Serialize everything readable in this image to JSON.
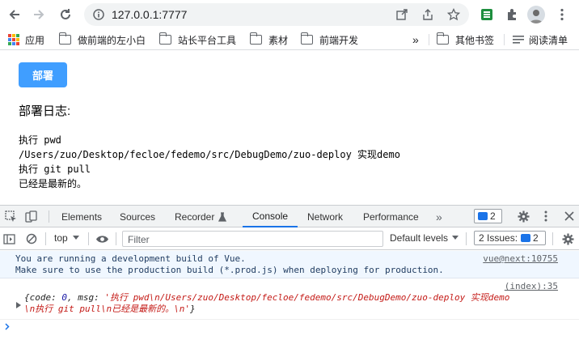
{
  "browser": {
    "url": "127.0.0.1:7777",
    "bookmarks": [
      "应用",
      "做前端的左小白",
      "站长平台工具",
      "素材",
      "前端开发"
    ],
    "more": "»",
    "other_bookmarks": "其他书签",
    "reading_list": "阅读清单"
  },
  "page": {
    "deploy_button": "部署",
    "log_title": "部署日志:",
    "log_lines": [
      "执行 pwd",
      "/Users/zuo/Desktop/fecloe/fedemo/src/DebugDemo/zuo-deploy 实现demo",
      "执行 git pull",
      "已经是最新的。"
    ]
  },
  "devtools": {
    "tabs": [
      "Elements",
      "Sources",
      "Recorder",
      "Console",
      "Network",
      "Performance"
    ],
    "active_tab": "Console",
    "more_tabs": "»",
    "issues_badge": "2",
    "context": "top",
    "filter_placeholder": "Filter",
    "levels": "Default levels",
    "issues_label": "2 Issues:",
    "issues_count": "2",
    "message1": {
      "line1": "You are running a development build of Vue.",
      "line2": "Make sure to use the production build (*.prod.js) when deploying for production.",
      "source": "vue@next:10755"
    },
    "message2": {
      "source": "(index):35",
      "open": "{",
      "k_code": "code",
      "v_code": "0",
      "k_msg": "msg",
      "v_msg_line1": "'执行 pwd\\n/Users/zuo/Desktop/fecloe/fedemo/src/DebugDemo/zuo-deploy 实现demo",
      "v_msg_line2": "\\n执行 git pull\\n已经是最新的。\\n'",
      "close": "}"
    }
  },
  "colors": {
    "deploy_button": "#409eff",
    "devtools_active": "#1a73e8",
    "string": "#c41a16",
    "number": "#1a1aa6"
  }
}
